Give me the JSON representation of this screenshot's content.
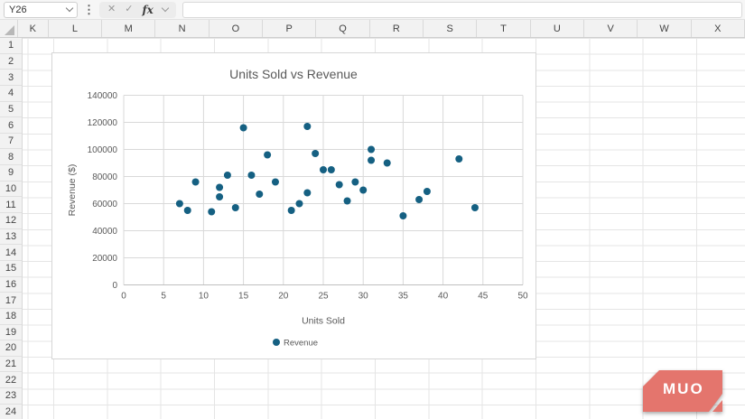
{
  "topbar": {
    "name_box_value": "Y26",
    "formula_bar": {
      "cancel_glyph": "✕",
      "confirm_glyph": "✓",
      "fx_label": "fx",
      "value": "",
      "placeholder": ""
    }
  },
  "sheet": {
    "columns": [
      "K",
      "L",
      "M",
      "N",
      "O",
      "P",
      "Q",
      "R",
      "S",
      "T",
      "U",
      "V",
      "W",
      "X"
    ],
    "rows": [
      "1",
      "2",
      "3",
      "4",
      "5",
      "6",
      "7",
      "8",
      "9",
      "10",
      "11",
      "12",
      "13",
      "14",
      "15",
      "16",
      "17",
      "18",
      "19",
      "20",
      "21",
      "22",
      "23",
      "24"
    ]
  },
  "chart_data": {
    "type": "scatter",
    "title": "Units Sold vs Revenue",
    "xlabel": "Units Sold",
    "ylabel": "Revenue ($)",
    "xlim": [
      0,
      50
    ],
    "ylim": [
      0,
      140000
    ],
    "xticks": [
      0,
      5,
      10,
      15,
      20,
      25,
      30,
      35,
      40,
      45,
      50
    ],
    "yticks": [
      0,
      20000,
      40000,
      60000,
      80000,
      100000,
      120000,
      140000
    ],
    "grid": true,
    "legend_position": "bottom",
    "marker_color": "#156082",
    "text_color": "#595959",
    "gridline_color": "#d9d9d9",
    "series": [
      {
        "name": "Revenue",
        "points": [
          [
            7,
            60000
          ],
          [
            8,
            55000
          ],
          [
            9,
            76000
          ],
          [
            11,
            54000
          ],
          [
            12,
            72000
          ],
          [
            12,
            65000
          ],
          [
            13,
            81000
          ],
          [
            14,
            57000
          ],
          [
            15,
            116000
          ],
          [
            16,
            81000
          ],
          [
            17,
            67000
          ],
          [
            18,
            96000
          ],
          [
            19,
            76000
          ],
          [
            21,
            55000
          ],
          [
            22,
            60000
          ],
          [
            23,
            117000
          ],
          [
            23,
            68000
          ],
          [
            24,
            97000
          ],
          [
            25,
            85000
          ],
          [
            26,
            85000
          ],
          [
            27,
            74000
          ],
          [
            28,
            62000
          ],
          [
            29,
            76000
          ],
          [
            30,
            70000
          ],
          [
            31,
            100000
          ],
          [
            31,
            92000
          ],
          [
            33,
            90000
          ],
          [
            35,
            51000
          ],
          [
            37,
            63000
          ],
          [
            38,
            69000
          ],
          [
            42,
            93000
          ],
          [
            44,
            57000
          ]
        ]
      }
    ]
  },
  "watermark": {
    "text": "MUO",
    "color": "#e4756d"
  }
}
